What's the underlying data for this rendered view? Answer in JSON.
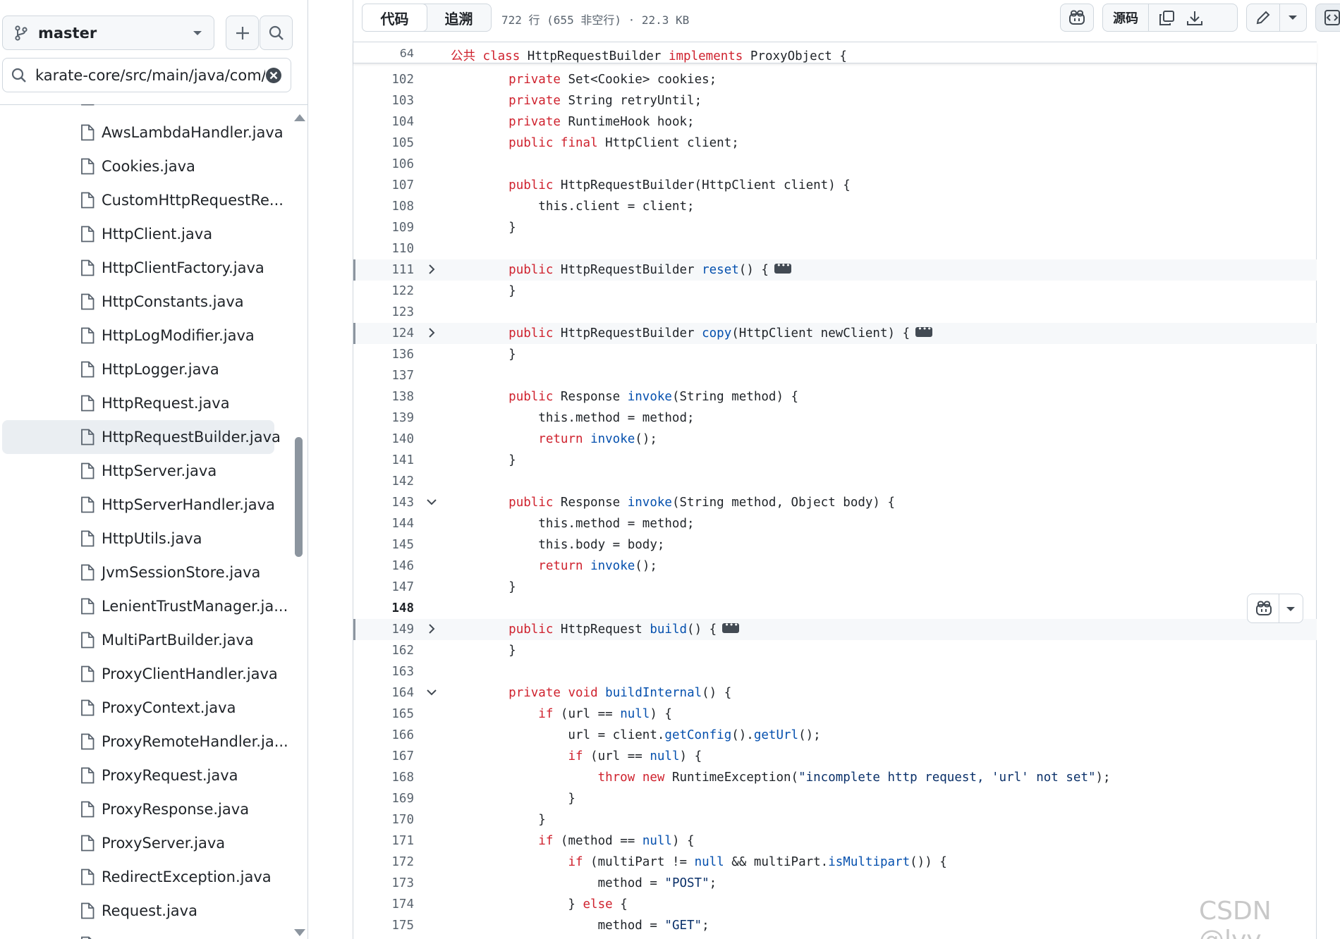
{
  "branch": {
    "name": "master"
  },
  "file_search": {
    "value": "karate-core/src/main/java/com/i"
  },
  "tree": {
    "selected": "HttpRequestBuilder.java",
    "files": [
      "AwsLambdaHandler.java",
      "Cookies.java",
      "CustomHttpRequestRe...",
      "HttpClient.java",
      "HttpClientFactory.java",
      "HttpConstants.java",
      "HttpLogModifier.java",
      "HttpLogger.java",
      "HttpRequest.java",
      "HttpRequestBuilder.java",
      "HttpServer.java",
      "HttpServerHandler.java",
      "HttpUtils.java",
      "JvmSessionStore.java",
      "LenientTrustManager.ja...",
      "MultiPartBuilder.java",
      "ProxyClientHandler.java",
      "ProxyContext.java",
      "ProxyRemoteHandler.ja...",
      "ProxyRequest.java",
      "ProxyResponse.java",
      "ProxyServer.java",
      "RedirectException.java",
      "Request.java"
    ]
  },
  "header": {
    "tabs": [
      "代码",
      "追溯"
    ],
    "active_tab": "代码",
    "file_info": "722 行 (655 非空行) · 22.3 KB",
    "raw_label": "源码"
  },
  "sticky": {
    "line_number": "64",
    "prefix": "公共",
    "kw_class": "class",
    "class_name": "HttpRequestBuilder",
    "kw_implements": "implements",
    "rest": "ProxyObject {"
  },
  "code_lines": [
    {
      "n": "102",
      "hl": false,
      "fold": "",
      "tokens": [
        [
          "",
          "    "
        ],
        [
          "k",
          "private"
        ],
        [
          "",
          " Set<Cookie> cookies;"
        ]
      ]
    },
    {
      "n": "103",
      "hl": false,
      "fold": "",
      "tokens": [
        [
          "",
          "    "
        ],
        [
          "k",
          "private"
        ],
        [
          "",
          " String retryUntil;"
        ]
      ]
    },
    {
      "n": "104",
      "hl": false,
      "fold": "",
      "tokens": [
        [
          "",
          "    "
        ],
        [
          "k",
          "private"
        ],
        [
          "",
          " RuntimeHook hook;"
        ]
      ]
    },
    {
      "n": "105",
      "hl": false,
      "fold": "",
      "tokens": [
        [
          "",
          "    "
        ],
        [
          "k",
          "public"
        ],
        [
          "",
          " "
        ],
        [
          "k",
          "final"
        ],
        [
          "",
          " HttpClient client;"
        ]
      ]
    },
    {
      "n": "106",
      "hl": false,
      "fold": "",
      "tokens": []
    },
    {
      "n": "107",
      "hl": false,
      "fold": "",
      "tokens": [
        [
          "",
          "    "
        ],
        [
          "k",
          "public"
        ],
        [
          "",
          " HttpRequestBuilder(HttpClient client) {"
        ]
      ]
    },
    {
      "n": "108",
      "hl": false,
      "fold": "",
      "tokens": [
        [
          "",
          "        this.client = client;"
        ]
      ]
    },
    {
      "n": "109",
      "hl": false,
      "fold": "",
      "tokens": [
        [
          "",
          "    }"
        ]
      ]
    },
    {
      "n": "110",
      "hl": false,
      "fold": "",
      "tokens": []
    },
    {
      "n": "111",
      "hl": true,
      "fold": "right",
      "tokens": [
        [
          "",
          "    "
        ],
        [
          "k",
          "public"
        ],
        [
          "",
          " HttpRequestBuilder "
        ],
        [
          "f",
          "reset"
        ],
        [
          "",
          "() {"
        ],
        [
          "ell",
          ""
        ]
      ]
    },
    {
      "n": "122",
      "hl": false,
      "fold": "",
      "tokens": [
        [
          "",
          "    }"
        ]
      ]
    },
    {
      "n": "123",
      "hl": false,
      "fold": "",
      "tokens": []
    },
    {
      "n": "124",
      "hl": true,
      "fold": "right",
      "tokens": [
        [
          "",
          "    "
        ],
        [
          "k",
          "public"
        ],
        [
          "",
          " HttpRequestBuilder "
        ],
        [
          "f",
          "copy"
        ],
        [
          "",
          "(HttpClient newClient) {"
        ],
        [
          "ell",
          ""
        ]
      ]
    },
    {
      "n": "136",
      "hl": false,
      "fold": "",
      "tokens": [
        [
          "",
          "    }"
        ]
      ]
    },
    {
      "n": "137",
      "hl": false,
      "fold": "",
      "tokens": []
    },
    {
      "n": "138",
      "hl": false,
      "fold": "",
      "tokens": [
        [
          "",
          "    "
        ],
        [
          "k",
          "public"
        ],
        [
          "",
          " Response "
        ],
        [
          "f",
          "invoke"
        ],
        [
          "",
          "(String method) {"
        ]
      ]
    },
    {
      "n": "139",
      "hl": false,
      "fold": "",
      "tokens": [
        [
          "",
          "        this.method = method;"
        ]
      ]
    },
    {
      "n": "140",
      "hl": false,
      "fold": "",
      "tokens": [
        [
          "",
          "        "
        ],
        [
          "k",
          "return"
        ],
        [
          "",
          " "
        ],
        [
          "f",
          "invoke"
        ],
        [
          "",
          "();"
        ]
      ]
    },
    {
      "n": "141",
      "hl": false,
      "fold": "",
      "tokens": [
        [
          "",
          "    }"
        ]
      ]
    },
    {
      "n": "142",
      "hl": false,
      "fold": "",
      "tokens": []
    },
    {
      "n": "143",
      "hl": false,
      "fold": "down",
      "tokens": [
        [
          "",
          "    "
        ],
        [
          "k",
          "public"
        ],
        [
          "",
          " Response "
        ],
        [
          "f",
          "invoke"
        ],
        [
          "",
          "(String method, Object body) {"
        ]
      ]
    },
    {
      "n": "144",
      "hl": false,
      "fold": "",
      "tokens": [
        [
          "",
          "        this.method = method;"
        ]
      ]
    },
    {
      "n": "145",
      "hl": false,
      "fold": "",
      "tokens": [
        [
          "",
          "        this.body = body;"
        ]
      ]
    },
    {
      "n": "146",
      "hl": false,
      "fold": "",
      "tokens": [
        [
          "",
          "        "
        ],
        [
          "k",
          "return"
        ],
        [
          "",
          " "
        ],
        [
          "f",
          "invoke"
        ],
        [
          "",
          "();"
        ]
      ]
    },
    {
      "n": "147",
      "hl": false,
      "fold": "",
      "tokens": [
        [
          "",
          "    }"
        ]
      ]
    },
    {
      "n": "148",
      "hl": false,
      "fold": "",
      "cur": true,
      "tokens": []
    },
    {
      "n": "149",
      "hl": true,
      "fold": "right",
      "tokens": [
        [
          "",
          "    "
        ],
        [
          "k",
          "public"
        ],
        [
          "",
          " HttpRequest "
        ],
        [
          "f",
          "build"
        ],
        [
          "",
          "() {"
        ],
        [
          "ell",
          ""
        ]
      ]
    },
    {
      "n": "162",
      "hl": false,
      "fold": "",
      "tokens": [
        [
          "",
          "    }"
        ]
      ]
    },
    {
      "n": "163",
      "hl": false,
      "fold": "",
      "tokens": []
    },
    {
      "n": "164",
      "hl": false,
      "fold": "down",
      "tokens": [
        [
          "",
          "    "
        ],
        [
          "k",
          "private"
        ],
        [
          "",
          " "
        ],
        [
          "k",
          "void"
        ],
        [
          "",
          " "
        ],
        [
          "f",
          "buildInternal"
        ],
        [
          "",
          "() {"
        ]
      ]
    },
    {
      "n": "165",
      "hl": false,
      "fold": "",
      "tokens": [
        [
          "",
          "        "
        ],
        [
          "k",
          "if"
        ],
        [
          "",
          " (url == "
        ],
        [
          "n",
          "null"
        ],
        [
          "",
          ") {"
        ]
      ]
    },
    {
      "n": "166",
      "hl": false,
      "fold": "",
      "tokens": [
        [
          "",
          "            url = client."
        ],
        [
          "f",
          "getConfig"
        ],
        [
          "",
          "()."
        ],
        [
          "f",
          "getUrl"
        ],
        [
          "",
          "();"
        ]
      ]
    },
    {
      "n": "167",
      "hl": false,
      "fold": "",
      "tokens": [
        [
          "",
          "            "
        ],
        [
          "k",
          "if"
        ],
        [
          "",
          " (url == "
        ],
        [
          "n",
          "null"
        ],
        [
          "",
          ") {"
        ]
      ]
    },
    {
      "n": "168",
      "hl": false,
      "fold": "",
      "tokens": [
        [
          "",
          "                "
        ],
        [
          "k",
          "throw"
        ],
        [
          "",
          " "
        ],
        [
          "k",
          "new"
        ],
        [
          "",
          " RuntimeException("
        ],
        [
          "s",
          "\"incomplete http request, 'url' not set\""
        ],
        [
          "",
          ");"
        ]
      ]
    },
    {
      "n": "169",
      "hl": false,
      "fold": "",
      "tokens": [
        [
          "",
          "            }"
        ]
      ]
    },
    {
      "n": "170",
      "hl": false,
      "fold": "",
      "tokens": [
        [
          "",
          "        }"
        ]
      ]
    },
    {
      "n": "171",
      "hl": false,
      "fold": "",
      "tokens": [
        [
          "",
          "        "
        ],
        [
          "k",
          "if"
        ],
        [
          "",
          " (method == "
        ],
        [
          "n",
          "null"
        ],
        [
          "",
          ") {"
        ]
      ]
    },
    {
      "n": "172",
      "hl": false,
      "fold": "",
      "tokens": [
        [
          "",
          "            "
        ],
        [
          "k",
          "if"
        ],
        [
          "",
          " (multiPart != "
        ],
        [
          "n",
          "null"
        ],
        [
          "",
          " && multiPart."
        ],
        [
          "f",
          "isMultipart"
        ],
        [
          "",
          "()) {"
        ]
      ]
    },
    {
      "n": "173",
      "hl": false,
      "fold": "",
      "tokens": [
        [
          "",
          "                method = "
        ],
        [
          "s",
          "\"POST\""
        ],
        [
          "",
          ";"
        ]
      ]
    },
    {
      "n": "174",
      "hl": false,
      "fold": "",
      "tokens": [
        [
          "",
          "            } "
        ],
        [
          "k",
          "else"
        ],
        [
          "",
          " {"
        ]
      ]
    },
    {
      "n": "175",
      "hl": false,
      "fold": "",
      "tokens": [
        [
          "",
          "                method = "
        ],
        [
          "s",
          "\"GET\""
        ],
        [
          "",
          ";"
        ]
      ]
    }
  ],
  "watermark": "CSDN @lvy-",
  "colors": {
    "keyword": "#cf222e",
    "function": "#0550ae",
    "string": "#0a3069",
    "selected_bg": "#eaeef2"
  }
}
